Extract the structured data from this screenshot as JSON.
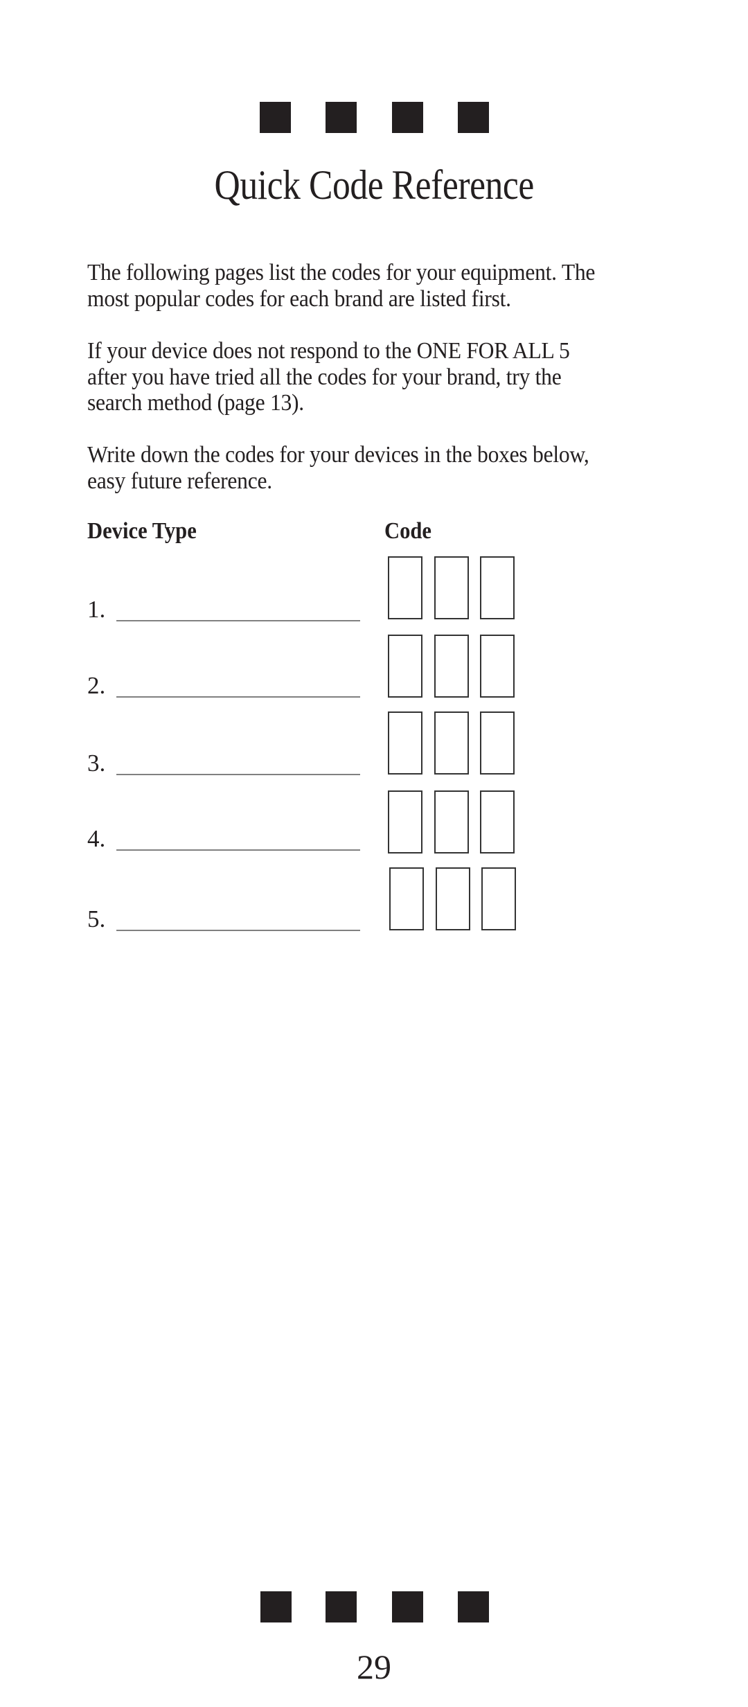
{
  "page": {
    "title": "Quick Code Reference",
    "paragraphs": [
      {
        "lines": [
          "The following pages list the codes for your equipment. The",
          "most popular codes for each brand are listed first."
        ]
      },
      {
        "lines": [
          "If your device does not respond to the ONE FOR ALL 5",
          "after you have tried all the codes for your brand, try the",
          "search method (page 13)."
        ]
      },
      {
        "lines": [
          "Write down the codes for your devices in the boxes below,",
          "easy future reference."
        ]
      }
    ],
    "table": {
      "device_header": "Device Type",
      "code_header": "Code",
      "rows": [
        {
          "number": "1.",
          "device": "",
          "code": [
            "",
            "",
            ""
          ]
        },
        {
          "number": "2.",
          "device": "",
          "code": [
            "",
            "",
            ""
          ]
        },
        {
          "number": "3.",
          "device": "",
          "code": [
            "",
            "",
            ""
          ]
        },
        {
          "number": "4.",
          "device": "",
          "code": [
            "",
            "",
            ""
          ]
        },
        {
          "number": "5.",
          "device": "",
          "code": [
            "",
            "",
            ""
          ]
        }
      ]
    },
    "page_number": "29",
    "decor_color": "#231f20"
  }
}
